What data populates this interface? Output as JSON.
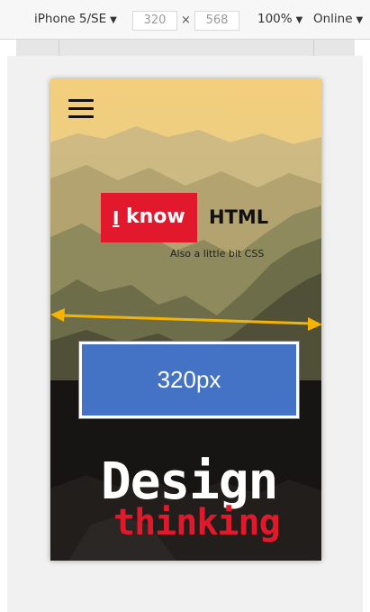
{
  "toolbar": {
    "device": "iPhone 5/SE",
    "width_value": "320",
    "height_value": "568",
    "dimension_separator": "×",
    "zoom": "100%",
    "network": "Online",
    "caret": "▼"
  },
  "hero": {
    "logo_i": "I",
    "logo_know": "know",
    "logo_html": "HTML",
    "tagline": "Also a little bit CSS"
  },
  "bottom": {
    "title_line1": "Design",
    "title_line2": "thinking"
  },
  "annotation": {
    "label": "320px",
    "arrow_color": "#f5b400",
    "box_color": "#4472c4"
  },
  "colors": {
    "brand_red": "#e2192c"
  },
  "icons": [
    "hamburger-menu-icon",
    "dropdown-caret-icon",
    "double-arrow-icon"
  ]
}
